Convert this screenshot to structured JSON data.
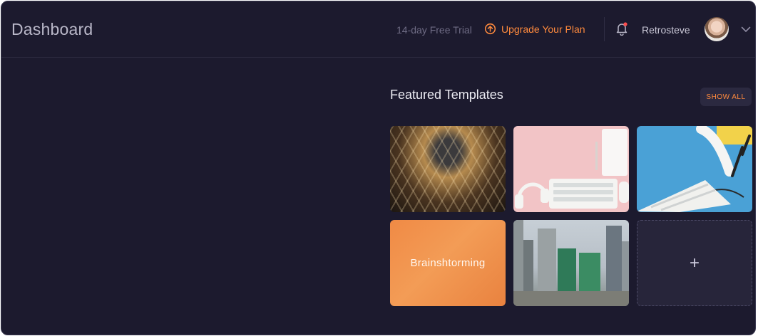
{
  "header": {
    "title": "Dashboard",
    "trial_text": "14-day Free Trial",
    "upgrade_label": "Upgrade Your Plan",
    "username": "Retrosteve",
    "notification_icon": "bell-icon",
    "upgrade_icon": "arrow-up-circle-icon",
    "menu_icon": "chevron-down-icon"
  },
  "featured": {
    "title": "Featured Templates",
    "show_all_label": "SHOW ALL",
    "templates": [
      {
        "image": "geodesic-dome-photo"
      },
      {
        "image": "pink-desk-keyboard-photo"
      },
      {
        "image": "blue-desk-phone-keyboard-photo"
      },
      {
        "label": "Brainshtorming"
      },
      {
        "image": "city-skyline-photo"
      },
      {
        "label": "+"
      }
    ]
  },
  "colors": {
    "background": "#1c1a2e",
    "accent": "#ff8a3d",
    "text": "#ececf3",
    "muted": "#6f6c85"
  }
}
